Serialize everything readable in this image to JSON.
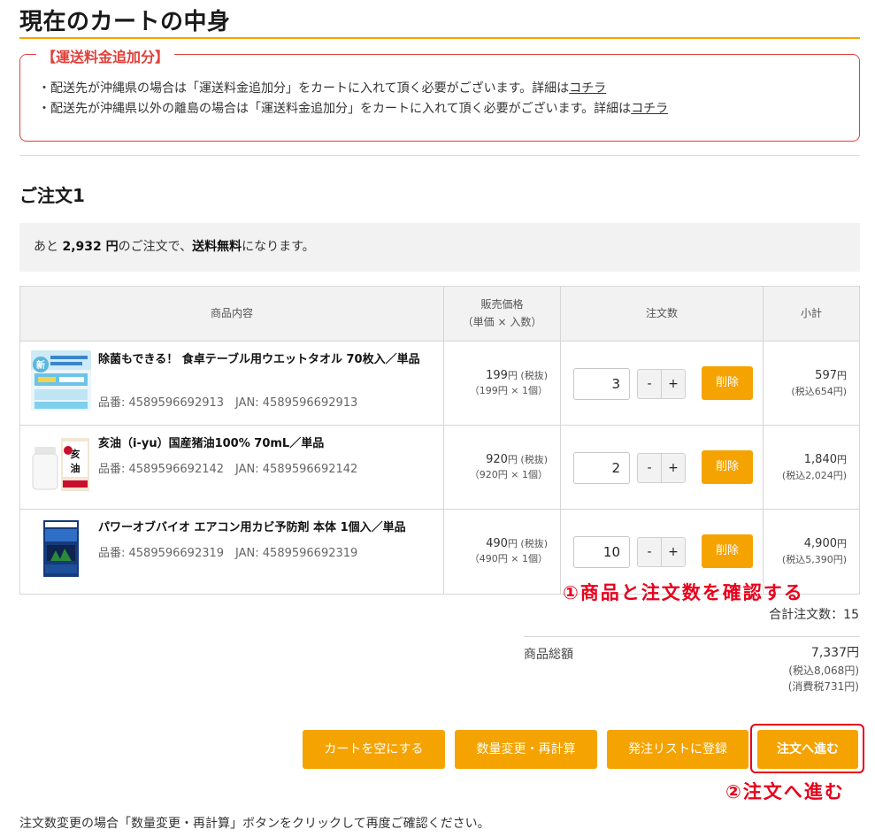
{
  "page": {
    "title": "現在のカートの中身"
  },
  "notice": {
    "title": "【運送料金追加分】",
    "line1": "・配送先が沖縄県の場合は「運送料金追加分」をカートに入れて頂く必要がございます。詳細は",
    "line1_link": "コチラ",
    "line2": "・配送先が沖縄県以外の離島の場合は「運送料金追加分」をカートに入れて頂く必要がございます。詳細は",
    "line2_link": "コチラ"
  },
  "order": {
    "heading": "ご注文1",
    "shipping_prefix": "あと ",
    "shipping_amount": "2,932 円",
    "shipping_middle": "のご注文で、",
    "shipping_free": "送料無料",
    "shipping_suffix": "になります。"
  },
  "table": {
    "headers": {
      "product": "商品内容",
      "price": "販売価格",
      "price_sub": "（単価 × 入数）",
      "qty": "注文数",
      "subtotal": "小計"
    },
    "rows": [
      {
        "name": "除菌もできる！ 食卓テーブル用ウエットタオル 70枚入／単品",
        "code": "品番: 4589596692913　JAN: 4589596692913",
        "price": "199",
        "price_unit": "円",
        "price_tax": " (税抜)",
        "price_detail": "（199円 × 1個）",
        "qty": "3",
        "delete_label": "削除",
        "subtotal": "597",
        "subtotal_unit": "円",
        "subtotal_tax": "(税込654円)",
        "image_icon": "wet-towel-product-image"
      },
      {
        "name": "亥油（i-yu）国産猪油100% 70mL／単品",
        "code": "品番: 4589596692142　JAN: 4589596692142",
        "price": "920",
        "price_unit": "円",
        "price_tax": " (税抜)",
        "price_detail": "（920円 × 1個）",
        "qty": "2",
        "delete_label": "削除",
        "subtotal": "1,840",
        "subtotal_unit": "円",
        "subtotal_tax": "(税込2,024円)",
        "image_icon": "boar-oil-product-image"
      },
      {
        "name": "パワーオブバイオ エアコン用カビ予防剤 本体 1個入／単品",
        "code": "品番: 4589596692319　JAN: 4589596692319",
        "price": "490",
        "price_unit": "円",
        "price_tax": " (税抜)",
        "price_detail": "（490円 × 1個）",
        "qty": "10",
        "delete_label": "削除",
        "subtotal": "4,900",
        "subtotal_unit": "円",
        "subtotal_tax": "(税込5,390円)",
        "image_icon": "aircon-mold-product-image"
      }
    ],
    "minus_label": "-",
    "plus_label": "+"
  },
  "annotations": {
    "step1": "①商品と注文数を確認する",
    "step2": "②注文へ進む"
  },
  "totals": {
    "total_qty_label": "合計注文数：",
    "total_qty": "15",
    "amount_label": "商品総額",
    "amount": "7,337円",
    "amount_tax_incl": "(税込8,068円)",
    "amount_tax": "(消費税731円)"
  },
  "actions": {
    "empty_cart": "カートを空にする",
    "recalc": "数量変更・再計算",
    "add_to_list": "発注リストに登録",
    "checkout": "注文へ進む"
  },
  "footnote": "注文数変更の場合「数量変更・再計算」ボタンをクリックして再度ご確認ください。",
  "colors": {
    "accent": "#f5a300",
    "alert": "#e1413b",
    "annotation": "#e8001c"
  }
}
